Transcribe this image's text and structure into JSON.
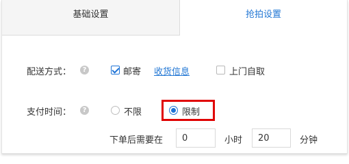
{
  "tabs": [
    {
      "label": "基础设置"
    },
    {
      "label": "抢拍设置"
    }
  ],
  "delivery": {
    "label": "配送方式：",
    "mail_label": "邮寄",
    "mail_checked": true,
    "shipping_info_link": "收货信息",
    "pickup_label": "上门自取",
    "pickup_checked": false
  },
  "payment_time": {
    "label": "支付时间：",
    "unlimited_label": "不限",
    "limited_label": "限制",
    "selected": "限制",
    "prefix": "下单后需要在",
    "hours_value": "0",
    "hours_unit": "小时",
    "minutes_value": "20",
    "minutes_unit": "分钟"
  },
  "help_icon_glyph": "?",
  "colors": {
    "accent": "#1e73d6",
    "highlight": "#e00000"
  }
}
